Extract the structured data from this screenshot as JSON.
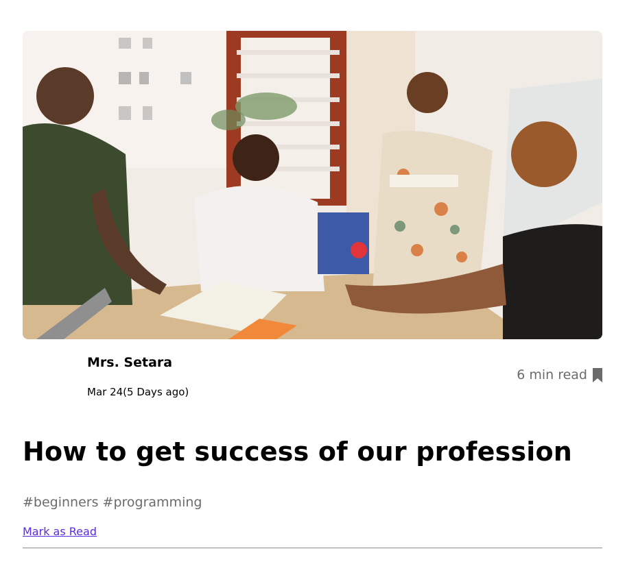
{
  "post": {
    "author": "Mrs. Setara",
    "date": "Mar 24(5 Days ago)",
    "read_time": "6 min read",
    "title": "How to get success of our profession",
    "tags": "#beginners #programming",
    "mark_read_label": "Mark as Read"
  },
  "icons": {
    "bookmark": "bookmark-icon"
  },
  "colors": {
    "link": "#5b2be0",
    "muted_text": "#6b6b6b",
    "divider": "#8a8a8a"
  }
}
